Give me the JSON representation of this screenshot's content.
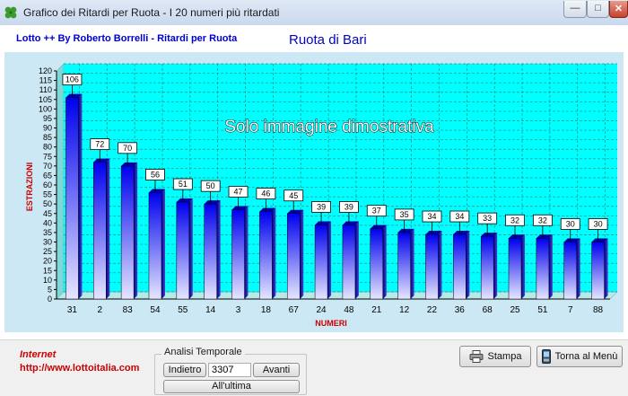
{
  "window": {
    "title": "Grafico dei Ritardi per Ruota - I 20 numeri più ritardati",
    "icon": "clover-icon",
    "minimize": "—",
    "maximize": "□",
    "close": "✕"
  },
  "header": {
    "app_subtitle": "Lotto ++ By Roberto Borrelli - Ritardi per Ruota",
    "ruota_title": "Ruota di Bari"
  },
  "chart_data": {
    "type": "bar",
    "title": "",
    "xlabel": "NUMERI",
    "ylabel": "ESTRAZIONI",
    "watermark": "Solo immagine dimostrativa",
    "ylim": [
      0,
      120
    ],
    "yticks": [
      0,
      5,
      10,
      15,
      20,
      25,
      30,
      35,
      40,
      45,
      50,
      55,
      60,
      65,
      70,
      75,
      80,
      85,
      90,
      95,
      100,
      105,
      110,
      115,
      120
    ],
    "grid": true,
    "legend": "none",
    "categories": [
      "31",
      "2",
      "83",
      "54",
      "55",
      "14",
      "3",
      "18",
      "67",
      "24",
      "48",
      "21",
      "12",
      "22",
      "36",
      "68",
      "25",
      "51",
      "7",
      "88"
    ],
    "values": [
      106,
      72,
      70,
      56,
      51,
      50,
      47,
      46,
      45,
      39,
      39,
      37,
      35,
      34,
      34,
      33,
      32,
      32,
      30,
      30
    ],
    "colors": {
      "plot_background": "#00ffff",
      "panel_background": "#cce8f4",
      "bar_top": "#0000ee",
      "bar_bottom": "#e6e6ff",
      "axis_title": "#cc0000",
      "grid": "#2a8a8a"
    }
  },
  "footer": {
    "internet_label": "Internet",
    "internet_url": "http://www.lottoitalia.com",
    "analisi_title": "Analisi Temporale",
    "indietro_label": "Indietro",
    "estrazione_value": "3307",
    "avanti_label": "Avanti",
    "ultima_label": "All'ultima",
    "stampa_label": "Stampa",
    "stampa_icon": "printer-icon",
    "torna_label": "Torna al Menù",
    "torna_icon": "phone-icon"
  }
}
